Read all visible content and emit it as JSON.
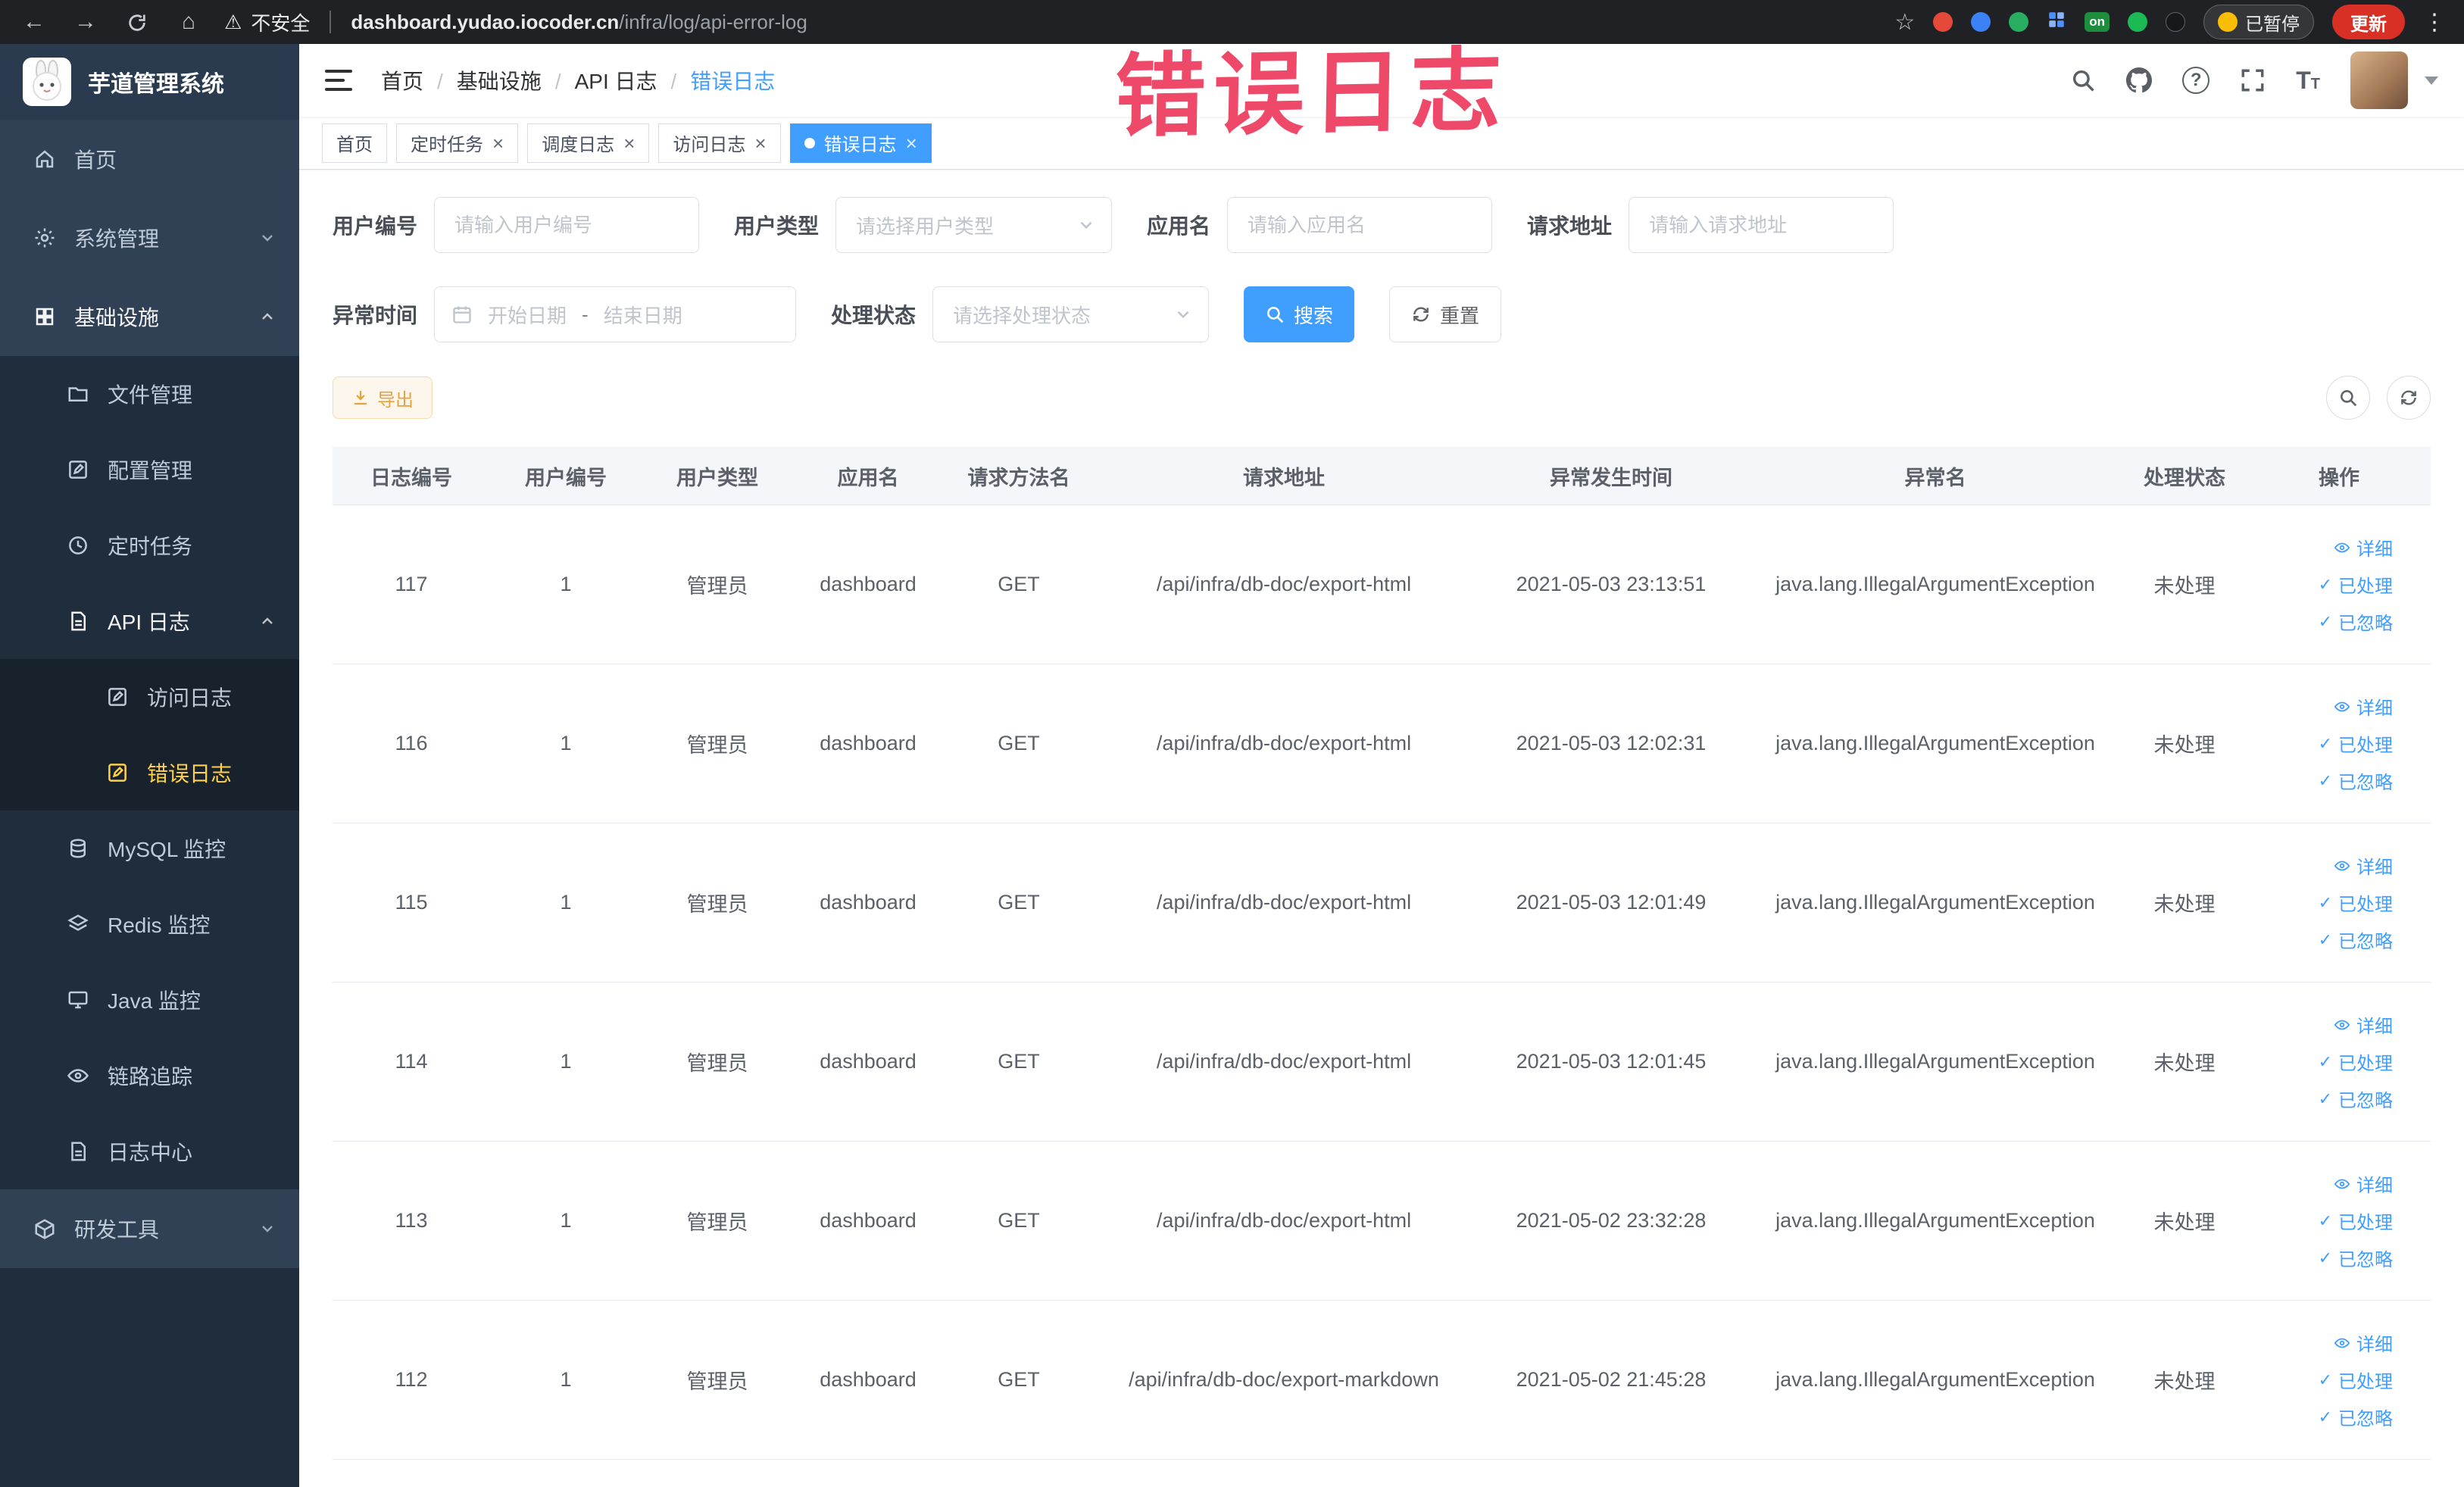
{
  "colors": {
    "accent": "#409eff",
    "sidebar_active": "#ffd04b",
    "annotation_red": "#ee3a5c",
    "warning": "#e6a23c",
    "update_red": "#d93025"
  },
  "annotation": {
    "text": "错误日志"
  },
  "browser": {
    "security_text": "不安全",
    "url_host": "dashboard.yudao.iocoder.cn",
    "url_path": "/infra/log/api-error-log",
    "extension_on_badge": "on",
    "paused_label": "已暂停",
    "update_label": "更新"
  },
  "logo": {
    "title": "芋道管理系统"
  },
  "breadcrumb": {
    "items": [
      "首页",
      "基础设施",
      "API 日志",
      "错误日志"
    ]
  },
  "sidebar": {
    "items": [
      {
        "label": "首页",
        "icon": "home-icon"
      },
      {
        "label": "系统管理",
        "icon": "gear-icon"
      },
      {
        "label": "基础设施",
        "icon": "grid-icon"
      },
      {
        "label": "文件管理",
        "icon": "folder-icon"
      },
      {
        "label": "配置管理",
        "icon": "edit-icon"
      },
      {
        "label": "定时任务",
        "icon": "clock-icon"
      },
      {
        "label": "API 日志",
        "icon": "doc-icon"
      },
      {
        "label": "访问日志",
        "icon": "edit-icon"
      },
      {
        "label": "错误日志",
        "icon": "edit-icon"
      },
      {
        "label": "MySQL 监控",
        "icon": "database-icon"
      },
      {
        "label": "Redis 监控",
        "icon": "layers-icon"
      },
      {
        "label": "Java 监控",
        "icon": "monitor-icon"
      },
      {
        "label": "链路追踪",
        "icon": "eye-icon"
      },
      {
        "label": "日志中心",
        "icon": "doc-icon"
      },
      {
        "label": "研发工具",
        "icon": "box-icon"
      }
    ]
  },
  "tabs": {
    "items": [
      {
        "label": "首页",
        "closable": false,
        "active": false
      },
      {
        "label": "定时任务",
        "closable": true,
        "active": false
      },
      {
        "label": "调度日志",
        "closable": true,
        "active": false
      },
      {
        "label": "访问日志",
        "closable": true,
        "active": false
      },
      {
        "label": "错误日志",
        "closable": true,
        "active": true
      }
    ]
  },
  "filters": {
    "user_id": {
      "label": "用户编号",
      "placeholder": "请输入用户编号"
    },
    "user_type": {
      "label": "用户类型",
      "placeholder": "请选择用户类型"
    },
    "app_name": {
      "label": "应用名",
      "placeholder": "请输入应用名"
    },
    "request_url": {
      "label": "请求地址",
      "placeholder": "请输入请求地址"
    },
    "exception_time": {
      "label": "异常时间",
      "start_placeholder": "开始日期",
      "range_separator": "-",
      "end_placeholder": "结束日期"
    },
    "process_status": {
      "label": "处理状态",
      "placeholder": "请选择处理状态"
    },
    "search_label": "搜索",
    "reset_label": "重置"
  },
  "toolbar": {
    "export_label": "导出"
  },
  "table": {
    "columns": [
      "日志编号",
      "用户编号",
      "用户类型",
      "应用名",
      "请求方法名",
      "请求地址",
      "异常发生时间",
      "异常名",
      "处理状态",
      "操作"
    ],
    "actions": {
      "detail": "详细",
      "processed": "已处理",
      "ignored": "已忽略"
    },
    "rows": [
      {
        "log_id": "117",
        "user_id": "1",
        "user_type": "管理员",
        "app_name": "dashboard",
        "method": "GET",
        "url": "/api/infra/db-doc/export-html",
        "time": "2021-05-03 23:13:51",
        "exception": "java.lang.IllegalArgumentException",
        "status": "未处理"
      },
      {
        "log_id": "116",
        "user_id": "1",
        "user_type": "管理员",
        "app_name": "dashboard",
        "method": "GET",
        "url": "/api/infra/db-doc/export-html",
        "time": "2021-05-03 12:02:31",
        "exception": "java.lang.IllegalArgumentException",
        "status": "未处理"
      },
      {
        "log_id": "115",
        "user_id": "1",
        "user_type": "管理员",
        "app_name": "dashboard",
        "method": "GET",
        "url": "/api/infra/db-doc/export-html",
        "time": "2021-05-03 12:01:49",
        "exception": "java.lang.IllegalArgumentException",
        "status": "未处理"
      },
      {
        "log_id": "114",
        "user_id": "1",
        "user_type": "管理员",
        "app_name": "dashboard",
        "method": "GET",
        "url": "/api/infra/db-doc/export-html",
        "time": "2021-05-03 12:01:45",
        "exception": "java.lang.IllegalArgumentException",
        "status": "未处理"
      },
      {
        "log_id": "113",
        "user_id": "1",
        "user_type": "管理员",
        "app_name": "dashboard",
        "method": "GET",
        "url": "/api/infra/db-doc/export-html",
        "time": "2021-05-02 23:32:28",
        "exception": "java.lang.IllegalArgumentException",
        "status": "未处理"
      },
      {
        "log_id": "112",
        "user_id": "1",
        "user_type": "管理员",
        "app_name": "dashboard",
        "method": "GET",
        "url": "/api/infra/db-doc/export-markdown",
        "time": "2021-05-02 21:45:28",
        "exception": "java.lang.IllegalArgumentException",
        "status": "未处理"
      }
    ]
  }
}
